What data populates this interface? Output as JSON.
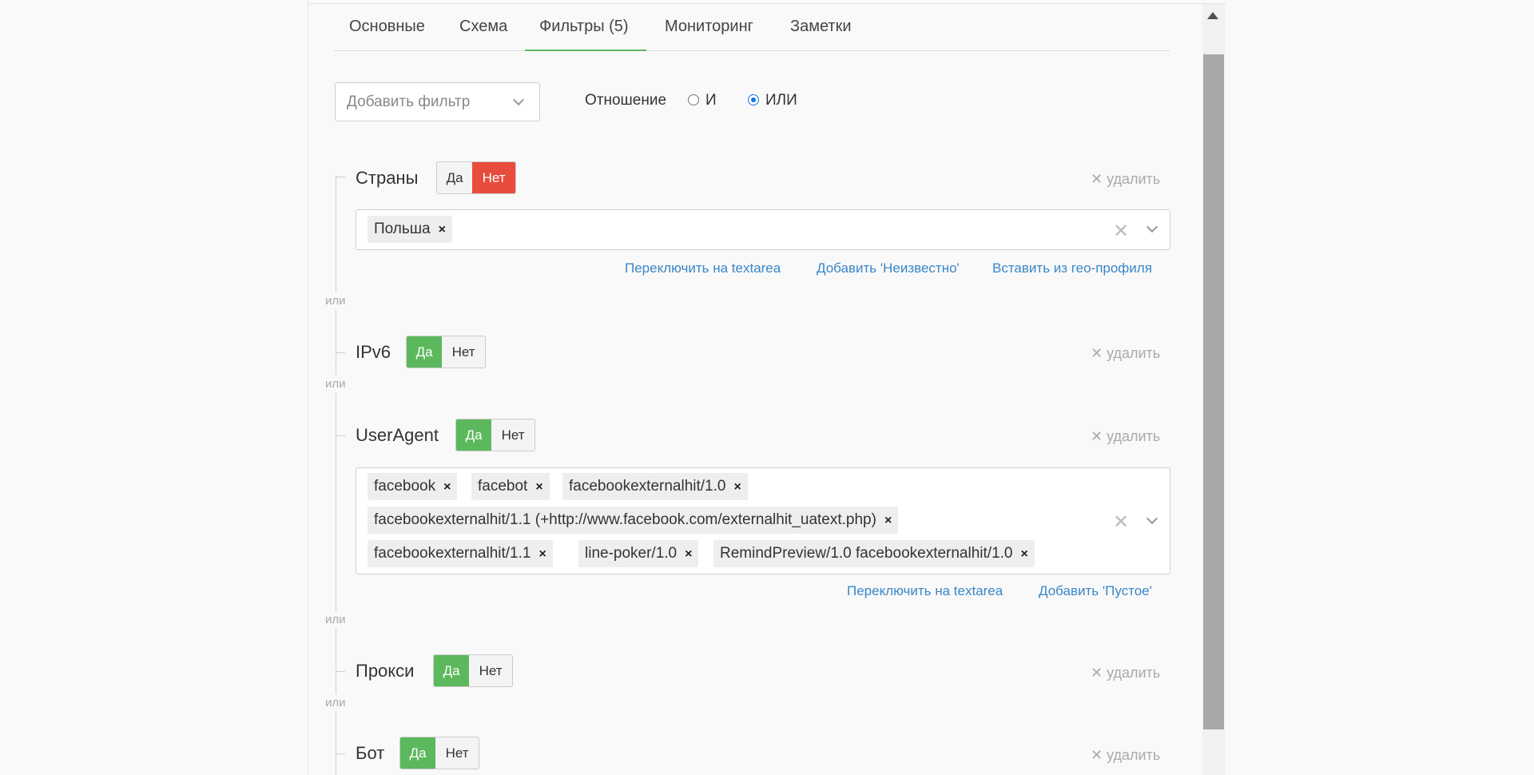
{
  "tabs": [
    {
      "label": "Основные"
    },
    {
      "label": "Схема"
    },
    {
      "label": "Фильтры (5)"
    },
    {
      "label": "Мониторинг"
    },
    {
      "label": "Заметки"
    }
  ],
  "toolbar": {
    "add_filter_placeholder": "Добавить фильтр",
    "relation_label": "Отношение",
    "relation_and": "И",
    "relation_or": "ИЛИ",
    "relation_selected": "ИЛИ"
  },
  "connector": "или",
  "filters": {
    "countries": {
      "name": "Страны",
      "yes": "Да",
      "no": "Нет",
      "selected": "Нет",
      "delete": "✕ удалить",
      "tags": [
        {
          "label": "Польша"
        }
      ],
      "links": [
        "Переключить на textarea",
        "Добавить 'Неизвестно'",
        "Вставить из гео-профиля"
      ]
    },
    "ipv6": {
      "name": "IPv6",
      "yes": "Да",
      "no": "Нет",
      "selected": "Да",
      "delete": "✕ удалить"
    },
    "useragent": {
      "name": "UserAgent",
      "yes": "Да",
      "no": "Нет",
      "selected": "Да",
      "delete": "✕ удалить",
      "tags": [
        {
          "label": "facebook"
        },
        {
          "label": "facebot"
        },
        {
          "label": "facebookexternalhit/1.0"
        },
        {
          "label": "facebookexternalhit/1.1 (+http://www.facebook.com/externalhit_uatext.php)"
        },
        {
          "label": "facebookexternalhit/1.1"
        },
        {
          "label": "line-poker/1.0"
        },
        {
          "label": "RemindPreview/1.0 facebookexternalhit/1.0"
        }
      ],
      "links": [
        "Переключить на textarea",
        "Добавить 'Пустое'"
      ]
    },
    "proxy": {
      "name": "Прокси",
      "yes": "Да",
      "no": "Нет",
      "selected": "Да",
      "delete": "✕ удалить"
    },
    "bot": {
      "name": "Бот",
      "yes": "Да",
      "no": "Нет",
      "selected": "Да",
      "delete": "✕ удалить"
    }
  },
  "icons": {
    "tag_remove": "×",
    "clear": "✕"
  }
}
